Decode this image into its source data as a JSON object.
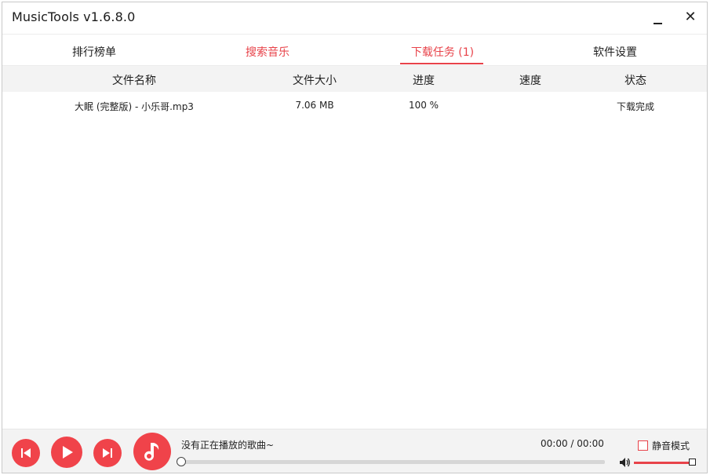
{
  "window": {
    "title": "MusicTools v1.6.8.0",
    "close_glyph": "✕"
  },
  "tabs": [
    {
      "label": "排行榜单",
      "active": false
    },
    {
      "label": "搜索音乐",
      "active": false
    },
    {
      "label": "下载任务 (1)",
      "active": true
    },
    {
      "label": "软件设置",
      "active": false
    }
  ],
  "table": {
    "headers": [
      "文件名称",
      "文件大小",
      "进度",
      "速度",
      "状态"
    ],
    "rows": [
      {
        "name": "大眠 (完整版) - 小乐哥.mp3",
        "size": "7.06 MB",
        "progress": "100 %",
        "speed": "",
        "status": "下载完成"
      }
    ]
  },
  "player": {
    "now_playing": "没有正在播放的歌曲~",
    "time": "00:00 / 00:00",
    "playback_progress": 0,
    "mute_label": "静音模式",
    "mute_checked": false,
    "volume": 1.0,
    "icons": {
      "prev": "skip-previous-icon",
      "play": "play-icon",
      "next": "skip-next-icon",
      "disc": "music-note-icon",
      "volume": "speaker-icon"
    }
  },
  "colors": {
    "accent": "#e8434a",
    "control": "#f0434a",
    "panel": "#f3f3f3"
  }
}
